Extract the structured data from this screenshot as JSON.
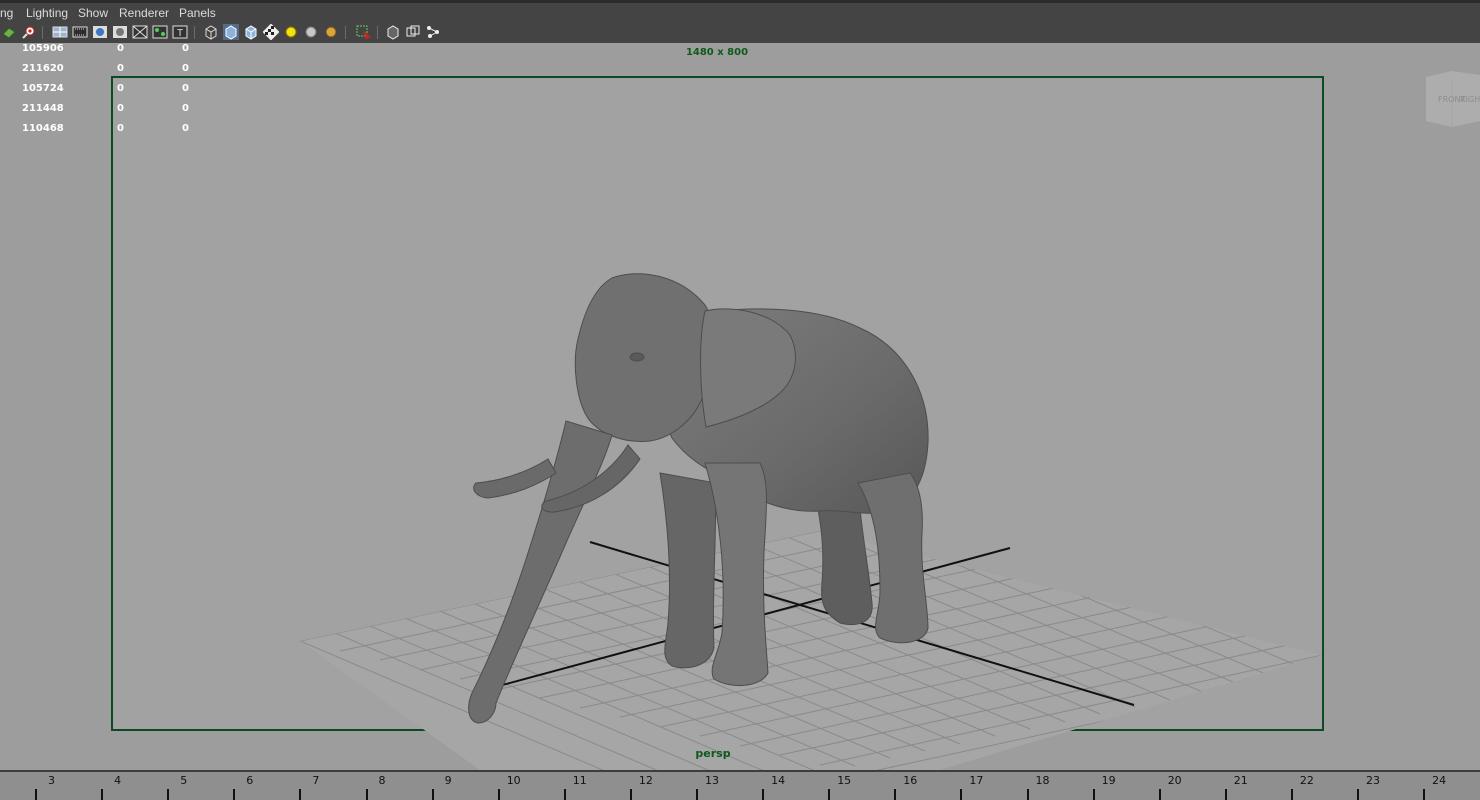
{
  "menubar": {
    "items": [
      "ng",
      "Lighting",
      "Show",
      "Renderer",
      "Panels"
    ]
  },
  "toolbar": {
    "icons": [
      "select-camera-icon",
      "camera-attributes-icon",
      "grid-icon",
      "film-gate-icon",
      "resolution-gate-icon",
      "gate-mask-icon",
      "field-chart-icon",
      "safe-action-icon",
      "safe-title-icon",
      "wireframe-icon",
      "smooth-shade-icon",
      "wireframe-on-shaded-icon",
      "textured-icon",
      "use-default-light-icon",
      "all-lights-icon",
      "shadows-icon",
      "isolate-select-icon",
      "xray-icon",
      "xray-joints-icon",
      "xray-components-icon"
    ]
  },
  "hud": {
    "rows": [
      [
        "105906",
        "0",
        "0"
      ],
      [
        "211620",
        "0",
        "0"
      ],
      [
        "105724",
        "0",
        "0"
      ],
      [
        "211448",
        "0",
        "0"
      ],
      [
        "110468",
        "0",
        "0"
      ]
    ],
    "resolution": "1480 x 800",
    "camera": "persp"
  },
  "viewcube": {
    "front": "FRONT",
    "right": "RIGHT"
  },
  "timeline": {
    "frames": [
      "3",
      "4",
      "5",
      "6",
      "7",
      "8",
      "9",
      "10",
      "11",
      "12",
      "13",
      "14",
      "15",
      "16",
      "17",
      "18",
      "19",
      "20",
      "21",
      "22",
      "23",
      "24"
    ]
  },
  "colors": {
    "panel": "#444444",
    "viewport_bg": "#9d9d9d",
    "gate_border": "#0c4a22",
    "hud_text": "#ffffff",
    "camera_label": "#0d5a1a"
  },
  "model": "elephant"
}
